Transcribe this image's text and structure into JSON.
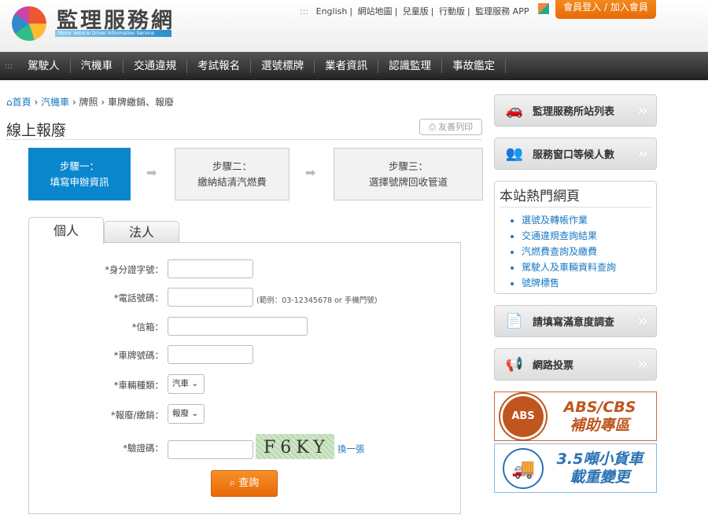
{
  "header": {
    "logo_title": "監理服務網",
    "logo_subtitle": "Motor Vehicle Driver Information Service",
    "top_links": [
      "English",
      "網站地圖",
      "兒童版",
      "行動版",
      "監理服務 APP"
    ],
    "login_button": "會員登入 / 加入會員"
  },
  "nav": {
    "items": [
      "駕駛人",
      "汽機車",
      "交通違規",
      "考試報名",
      "選號標牌",
      "業者資訊",
      "認識監理",
      "事故鑑定"
    ]
  },
  "breadcrumb": [
    "首頁",
    "汽機車",
    "牌照",
    "車牌繳銷、報廢"
  ],
  "page": {
    "title": "線上報廢",
    "print_button": "友善列印"
  },
  "steps": [
    {
      "line1": "步驟一：",
      "line2": "填寫申辦資訊",
      "active": true
    },
    {
      "line1": "步驟二：",
      "line2": "繳納結清汽燃費"
    },
    {
      "line1": "步驟三：",
      "line2": "選擇號牌回收管道"
    }
  ],
  "tabs": [
    {
      "label": "個人",
      "active": true
    },
    {
      "label": "法人"
    }
  ],
  "form": {
    "id_label": "*身分證字號：",
    "phone_label": "*電話號碼：",
    "phone_hint": "(範例：03-12345678 or 手機門號)",
    "email_label": "*信箱：",
    "plate_label": "*車牌號碼：",
    "vehicle_type_label": "*車輛種類：",
    "vehicle_type_value": "汽車",
    "action_label": "*報廢/繳銷：",
    "action_value": "報廢",
    "captcha_label": "*驗證碼：",
    "captcha_text": "F6KY",
    "refresh_captcha": "換一張",
    "submit": "查詢"
  },
  "sidebar": {
    "station_list": "監理服務所站列表",
    "waiting": "服務窗口等候人數",
    "hot_title": "本站熱門網頁",
    "hot_links": [
      "選號及轉帳作業",
      "交通違規查詢結果",
      "汽燃費查詢及繳費",
      "駕駛人及車輛資料查詢",
      "號牌標售"
    ],
    "survey": "請填寫滿意度調查",
    "vote": "網路投票",
    "abs_banner": {
      "badge": "ABS",
      "line1": "ABS/CBS",
      "line2": "補助專區"
    },
    "truck_banner": {
      "line1": "3.5噸小貨車",
      "line2": "載重變更"
    }
  },
  "colors": {
    "primary": "#0a86cc",
    "accent": "#e66a05",
    "abs": "#c0551e",
    "truck": "#2a72b5"
  }
}
